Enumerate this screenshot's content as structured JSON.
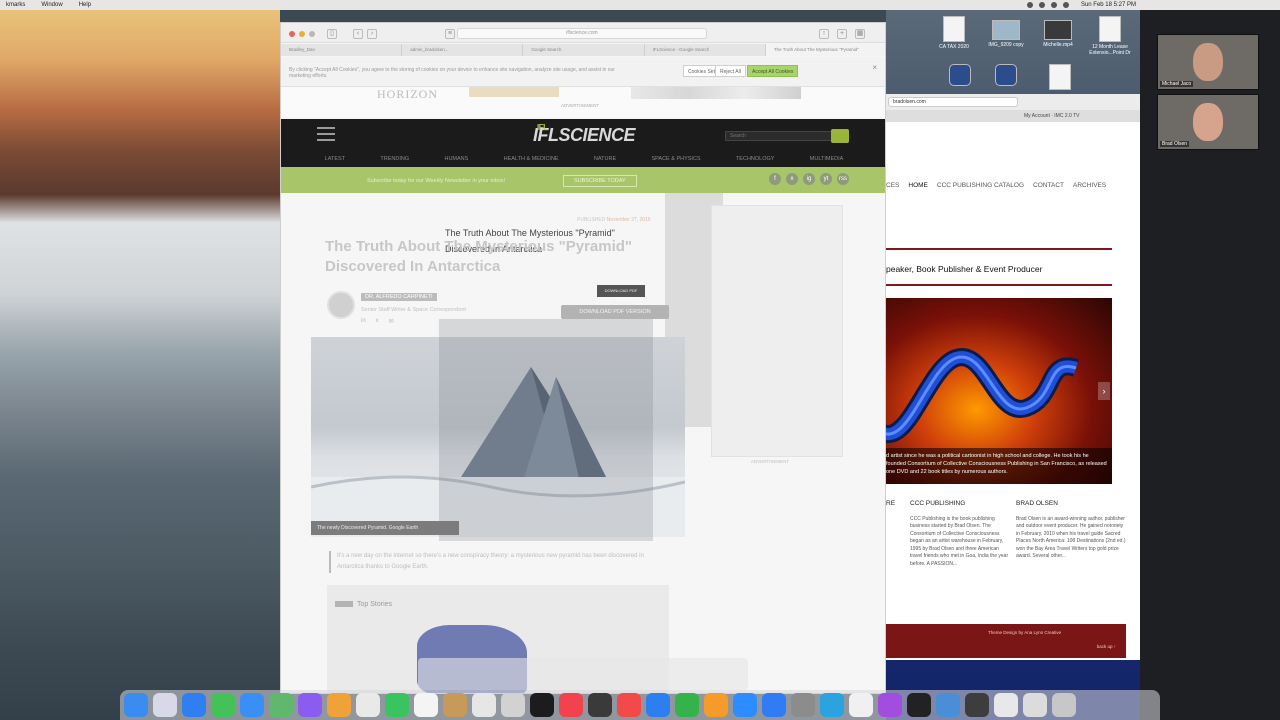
{
  "menubar": {
    "items": [
      "kmarks",
      "Window",
      "Help"
    ],
    "clock": "Sun Feb 18  5:27 PM"
  },
  "desktop_files": [
    {
      "label": "CA TAX 2020",
      "kind": "doc"
    },
    {
      "label": "IMG_9209 copy",
      "kind": "image"
    },
    {
      "label": "Michelle.mp4",
      "kind": "video"
    },
    {
      "label": "12 Month Lease Extensio...Point Dr",
      "kind": "doc"
    }
  ],
  "zoom": {
    "tiles": [
      {
        "name": "Michael Jaco"
      },
      {
        "name": "Brad Olsen"
      }
    ]
  },
  "back_browser": {
    "url": "bradolsen.com",
    "tab": "My Account · IMC 2.0 TV",
    "nav": [
      "CES",
      "HOME",
      "CCC PUBLISHING CATALOG",
      "CONTACT",
      "ARCHIVES"
    ],
    "tagline": "peaker, Book Publisher & Event Producer",
    "hero_caption": "d artist since he was a political cartoonist in high school and college. He took his he founded Consortium of Collective Consciousness Publishing in San Francisco, as released one DVD and 22 book titles by numerous authors.",
    "columns": [
      {
        "heading": "RE",
        "text": ""
      },
      {
        "heading": "CCC PUBLISHING",
        "text": "CCC Publishing is the book publishing business started by Brad Olsen. The Consortium of Collective Consciousness began as an artist warehouse in February, 1995 by Brad Olsen and three American travel friends who met in Goa, India the year before. A PASSION..."
      },
      {
        "heading": "BRAD OLSEN",
        "text": "Brad Olsen is an award-winning author, publisher and outdoor event producer. He gained notoriety in February, 2010 when his travel guide Sacred Places North America: 108 Destinations (2nd ed.) won the Bay Area Travel Writers top gold prize award.  Several other..."
      }
    ],
    "footer_credit": "Theme Design by Ana Lynn Creative",
    "footer_backup": "back up ↑"
  },
  "front_browser": {
    "address": "iflscience.com",
    "tabs": [
      "Bradley_Dan",
      "admin_bradolsen...",
      "Google Search",
      "IFLScience - Google Search",
      "The Truth About The Mysterious \"Pyramid\""
    ],
    "cookie_text": "By clicking \"Accept All Cookies\", you agree to the storing of cookies on your device to enhance site navigation, analyze site usage, and assist in our marketing efforts.",
    "cookie_settings": "Cookies Settings",
    "reject_label": "Reject All",
    "accept_label": "Accept All Cookies",
    "ad_logo": "HORIZON",
    "ad_label": "ADVERTISEMENT",
    "site_name": "IFLSCIENCE",
    "site_badge": "IFL",
    "search_placeholder": "Search",
    "site_nav": [
      "LATEST",
      "TRENDING",
      "HUMANS",
      "HEALTH & MEDICINE",
      "NATURE",
      "SPACE & PHYSICS",
      "TECHNOLOGY",
      "MULTIMEDIA"
    ],
    "newsletter_text": "Subscribe today for our Weekly Newsletter in your inbox!",
    "newsletter_button": "SUBSCRIBE TODAY",
    "social": [
      "f",
      "x",
      "ig",
      "yt",
      "rss"
    ],
    "article": {
      "title": "The Truth About The Mysterious \"Pyramid\" Discovered In Antarctica",
      "published_label": "PUBLISHED",
      "published_date": "November 27, 2016",
      "author": "DR. ALFREDO CARPINETI",
      "author_role": "Senior Staff Writer & Space Correspondent",
      "author_icons": [
        "in",
        "x",
        "✉"
      ],
      "pdf_button": "DOWNLOAD PDF VERSION",
      "image_caption": "The newly Discovered Pyramid. Google Earth",
      "lead": "It's a new day on the internet so there's a new conspiracy theory: a mysterious new pyramid has been discovered in Antarctica thanks to Google Earth.",
      "top_stories_label": "Top Stories",
      "ad_label": "ADVERTISEMENT"
    }
  },
  "colors": {
    "accent_green": "#a8c56a",
    "header_dark": "#1b1b1b",
    "back_site_red": "#7a1616"
  }
}
